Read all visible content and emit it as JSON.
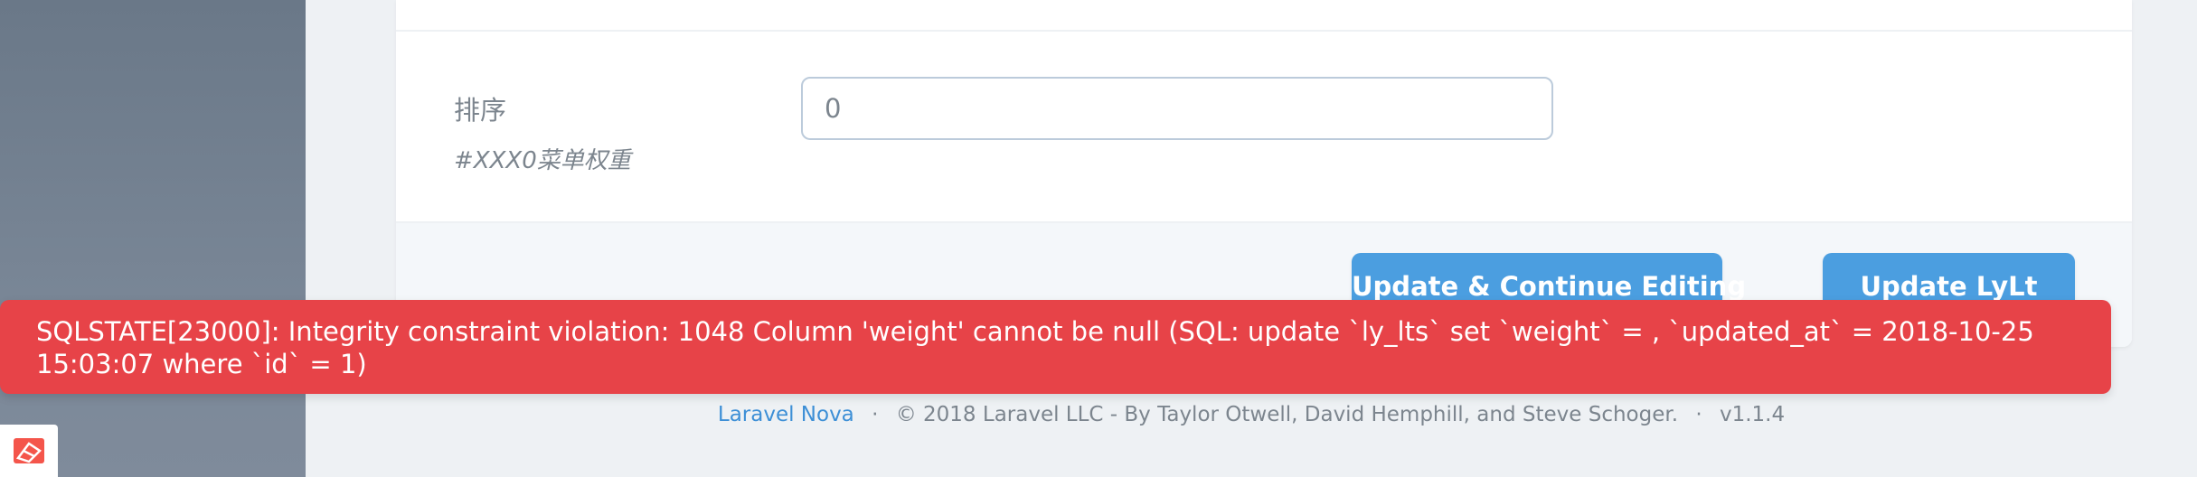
{
  "form": {
    "field_label": "排序",
    "field_help": "#XXX0菜单权重",
    "field_value": "0",
    "buttons": {
      "continue_label": "Update & Continue Editing",
      "update_label": "Update LyLt"
    }
  },
  "error_toast": {
    "message": "SQLSTATE[23000]: Integrity constraint violation: 1048 Column 'weight' cannot be null (SQL: update `ly_lts` set `weight` = , `updated_at` = 2018-10-25 15:03:07 where `id` = 1)"
  },
  "footer": {
    "link_text": "Laravel Nova",
    "separator": "·",
    "copyright": "© 2018 Laravel LLC - By Taylor Otwell, David Hemphill, and Steve Schoger.",
    "version": "v1.1.4"
  },
  "colors": {
    "accent": "#4b9ee0",
    "error": "#e74348",
    "sidebar": "#6a7888",
    "link": "#3d8fd6"
  },
  "icons": {
    "sidebar_logo": "laravel-logo-icon"
  }
}
